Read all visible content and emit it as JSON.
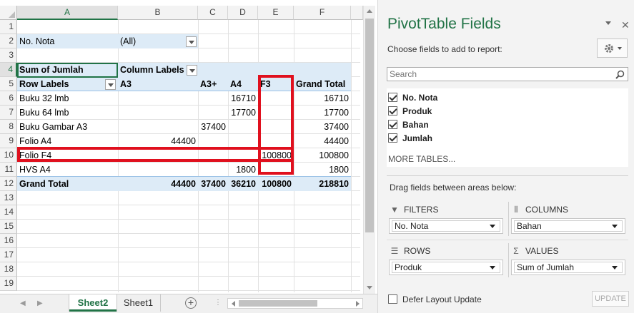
{
  "sheet": {
    "columns": [
      "A",
      "B",
      "C",
      "D",
      "E",
      "F"
    ],
    "rows": [
      "1",
      "2",
      "3",
      "4",
      "5",
      "6",
      "7",
      "8",
      "9",
      "10",
      "11",
      "12",
      "13",
      "14",
      "15",
      "16",
      "17",
      "18",
      "19"
    ],
    "filter": {
      "label": "No. Nota",
      "value": "(All)"
    },
    "values_label": "Sum of Jumlah",
    "column_labels": "Column Labels",
    "row_labels_header": "Row Labels",
    "col_headers": [
      "A3",
      "A3+",
      "A4",
      "F3",
      "Grand Total"
    ],
    "data_rows": [
      {
        "label": "Buku 32 lmb",
        "a3": "",
        "a3p": "",
        "a4": "16710",
        "f3": "",
        "total": "16710"
      },
      {
        "label": "Buku 64 lmb",
        "a3": "",
        "a3p": "",
        "a4": "17700",
        "f3": "",
        "total": "17700"
      },
      {
        "label": "Buku Gambar A3",
        "a3": "",
        "a3p": "37400",
        "a4": "",
        "f3": "",
        "total": "37400"
      },
      {
        "label": "Folio A4",
        "a3": "44400",
        "a3p": "",
        "a4": "",
        "f3": "",
        "total": "44400"
      },
      {
        "label": "Folio F4",
        "a3": "",
        "a3p": "",
        "a4": "",
        "f3": "100800",
        "total": "100800"
      },
      {
        "label": "HVS A4",
        "a3": "",
        "a3p": "",
        "a4": "1800",
        "f3": "",
        "total": "1800"
      }
    ],
    "grand_total": {
      "label": "Grand Total",
      "a3": "44400",
      "a3p": "37400",
      "a4": "36210",
      "f3": "100800",
      "total": "218810"
    }
  },
  "tabs": {
    "active": "Sheet2",
    "other": "Sheet1",
    "add": "+"
  },
  "pane": {
    "title": "PivotTable Fields",
    "close": "✕",
    "choose": "Choose fields to add to report:",
    "search_placeholder": "Search",
    "fields": [
      {
        "label": "No. Nota",
        "checked": true
      },
      {
        "label": "Produk",
        "checked": true
      },
      {
        "label": "Bahan",
        "checked": true
      },
      {
        "label": "Jumlah",
        "checked": true
      }
    ],
    "more_tables": "MORE TABLES...",
    "drag_text": "Drag fields between areas below:",
    "filters": {
      "title": "FILTERS",
      "value": "No. Nota"
    },
    "columns": {
      "title": "COLUMNS",
      "value": "Bahan"
    },
    "rows": {
      "title": "ROWS",
      "value": "Produk"
    },
    "values": {
      "title": "VALUES",
      "value": "Sum of Jumlah"
    },
    "defer_label": "Defer Layout Update",
    "update_label": "UPDATE"
  },
  "colors": {
    "accent": "#217346",
    "pivot_band": "#ddebf7",
    "highlight": "#e0101e"
  }
}
